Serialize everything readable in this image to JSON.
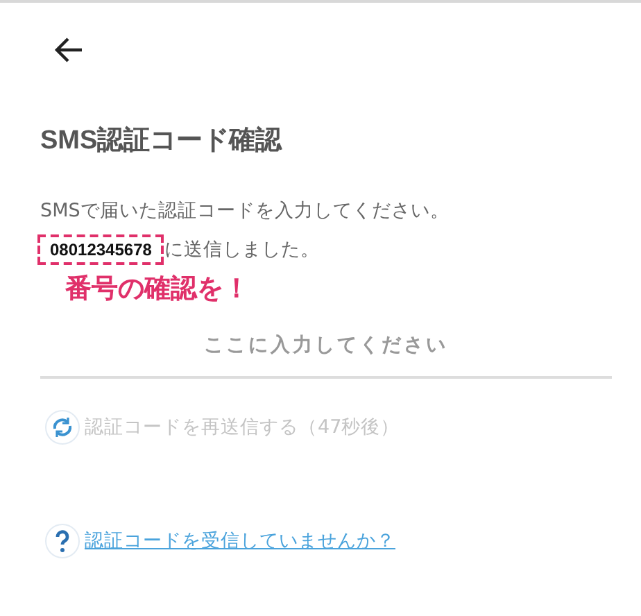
{
  "title": "SMS認証コード確認",
  "instruction": "SMSで届いた認証コードを入力してください。",
  "phone": {
    "number": "08012345678",
    "suffix": "に送信しました。"
  },
  "annotation": "番号の確認を！",
  "code_field": {
    "placeholder": "ここに入力してください"
  },
  "resend": {
    "label": "認証コードを再送信する（47秒後）",
    "disabled": true
  },
  "help_link": "認証コードを受信していませんか？"
}
